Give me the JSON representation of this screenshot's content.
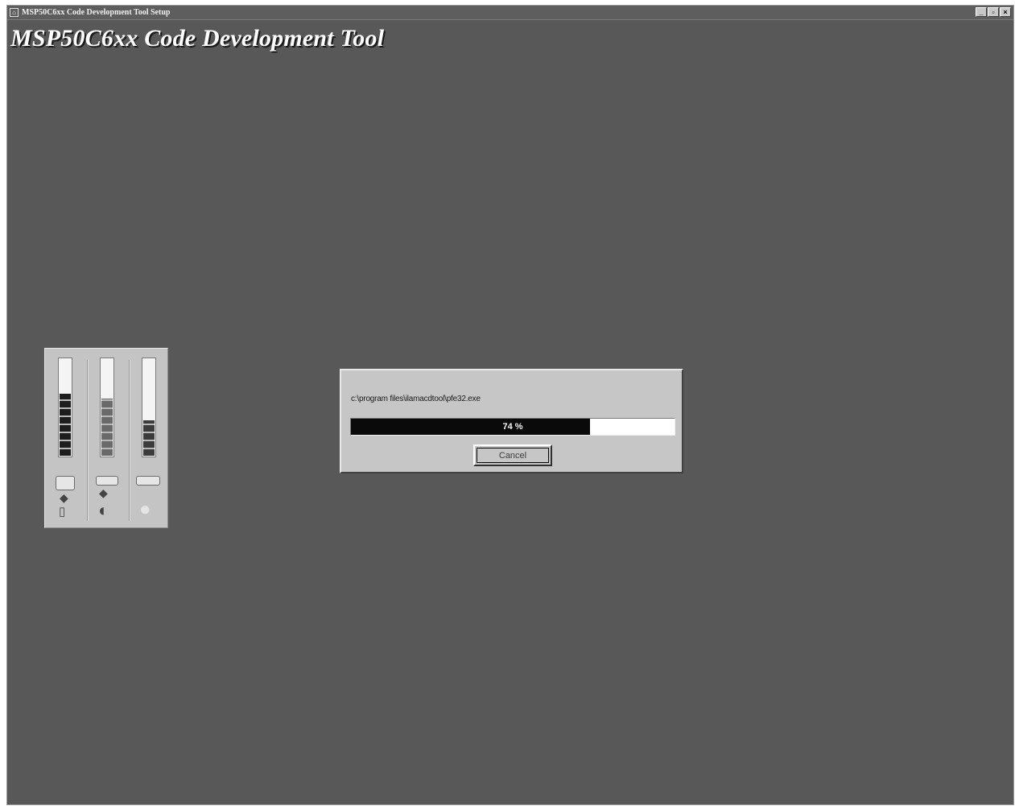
{
  "window": {
    "title": "MSP50C6xx Code Development Tool Setup",
    "controls": {
      "minimize": "_",
      "restore": "▫",
      "close": "×"
    }
  },
  "setup": {
    "title": "MSP50C6xx Code Development Tool"
  },
  "meters": [
    {
      "name": "disk-space-meter",
      "level": 0.65,
      "icon": "drive-icon",
      "icon2": "document-icon",
      "segment_color": "#1e1e1e"
    },
    {
      "name": "memory-meter",
      "level": 0.6,
      "icon": "drive-icon",
      "icon2": "cd-icon",
      "segment_color": "#6a6a6a"
    },
    {
      "name": "system-meter",
      "level": 0.38,
      "icon": "drive-icon",
      "icon2": "globe-icon",
      "segment_color": "#3c3c3c"
    }
  ],
  "progress_dialog": {
    "file_path": "c:\\program files\\ilamacdtool\\pfe32.exe",
    "percent": 74,
    "percent_label": "74 %",
    "cancel_label": "Cancel"
  },
  "colors": {
    "desktop": "#585858",
    "dialog": "#c6c6c6",
    "progress_fill": "#0a0a0a"
  }
}
